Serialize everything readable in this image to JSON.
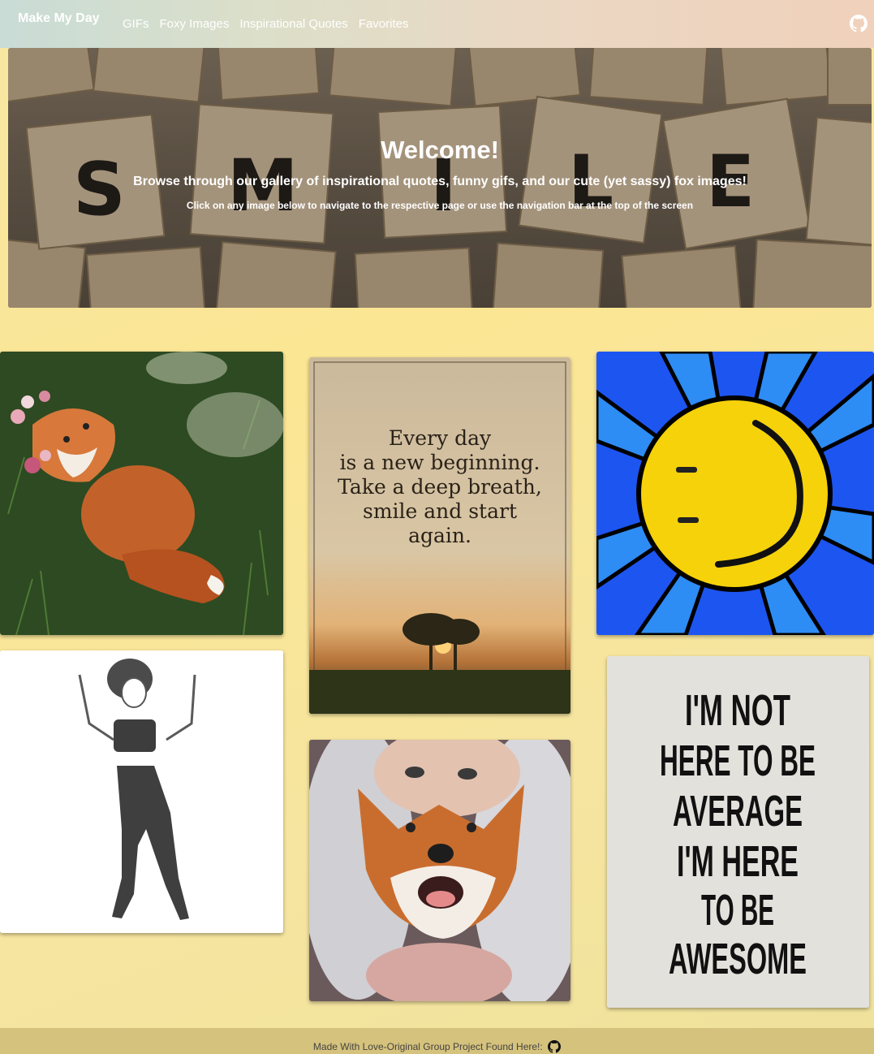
{
  "navbar": {
    "brand": "Make My Day",
    "links": [
      "GIFs",
      "Foxy Images",
      "Inspirational Quotes",
      "Favorites"
    ],
    "github_icon": "github-icon"
  },
  "hero": {
    "title": "Welcome!",
    "subtitle": "Browse through our gallery of inspirational quotes, funny gifs, and our cute (yet sassy) fox images!",
    "note": "Click on any image below to navigate to the respective page or use the navigation bar at the top of the screen",
    "tile_letters": [
      "S",
      "M",
      "I",
      "L",
      "E"
    ]
  },
  "gallery": {
    "quote_card_1": {
      "lines": [
        "Every day",
        "is a new beginning.",
        "Take a deep breath,",
        "smile and start",
        "again."
      ]
    },
    "quote_card_2": {
      "lines": [
        "I'M NOT",
        "HERE TO BE",
        "AVERAGE",
        "I'M HERE",
        "TO BE",
        "AWESOME"
      ]
    }
  },
  "footer": {
    "text": "Made With Love-Original Group Project Found Here!:",
    "github_icon": "github-icon"
  }
}
